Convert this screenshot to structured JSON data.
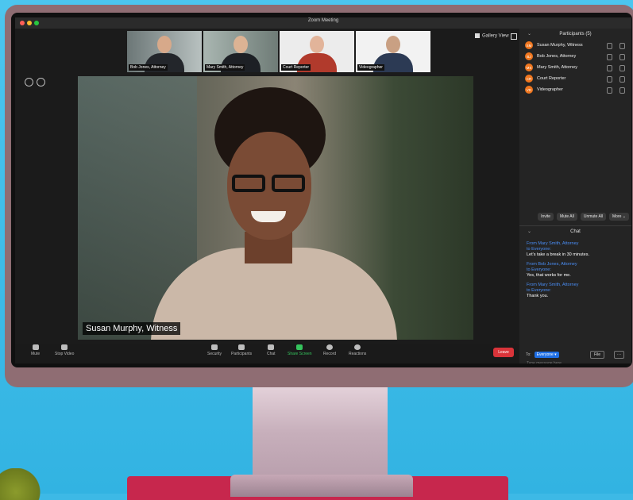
{
  "window": {
    "title": "Zoom Meeting"
  },
  "thumbnails": [
    {
      "name": "Bob Jones, Attorney"
    },
    {
      "name": "Mary Smith, Attorney"
    },
    {
      "name": "Court Reporter"
    },
    {
      "name": "Videographer"
    }
  ],
  "header": {
    "gallery_view": "Gallery View"
  },
  "main_video": {
    "label": "Susan Murphy, Witness"
  },
  "participants": {
    "title": "Participants (5)",
    "items": [
      {
        "initials": "SM",
        "name": "Susan Murphy, Witness"
      },
      {
        "initials": "BJ",
        "name": "Bob Jones, Attorney"
      },
      {
        "initials": "MS",
        "name": "Mary Smith, Attorney"
      },
      {
        "initials": "CR",
        "name": "Court Reporter"
      },
      {
        "initials": "VD",
        "name": "Videographer"
      }
    ],
    "buttons": {
      "invite": "Invite",
      "mute_all": "Mute All",
      "unmute_all": "Unmute All",
      "more": "More ⌄"
    }
  },
  "chat": {
    "title": "Chat",
    "messages": [
      {
        "from": "From Mary Smith, Attorney",
        "to": "to Everyone:",
        "text": "Let's take a break in 30 minutes."
      },
      {
        "from": "From Bob Jones, Attorney",
        "to": "to Everyone:",
        "text": "Yes, that works for me."
      },
      {
        "from": "From Mary Smith, Attorney",
        "to": "to Everyone:",
        "text": "Thank you."
      }
    ],
    "to_label": "To:",
    "to_value": "Everyone ▾",
    "file_label": "File",
    "more_label": "···",
    "placeholder": "Type message here..."
  },
  "toolbar": {
    "mute": "Mute",
    "stop_video": "Stop Video",
    "security": "Security",
    "participants": "Participants",
    "chat": "Chat",
    "share_screen": "Share Screen",
    "record": "Record",
    "reactions": "Reactions",
    "leave": "Leave"
  }
}
